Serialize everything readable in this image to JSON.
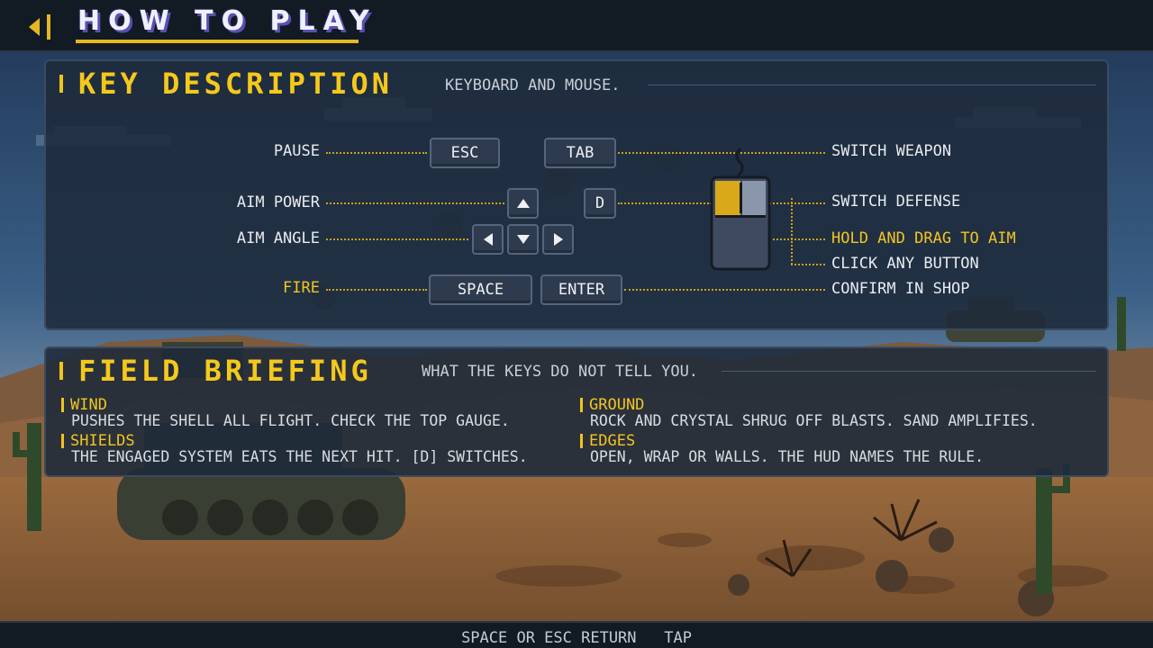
{
  "header": {
    "title": "HOW TO PLAY",
    "back_icon": "chevron-left-icon"
  },
  "key_description": {
    "title": "KEY DESCRIPTION",
    "subtitle": "KEYBOARD AND MOUSE.",
    "actions": {
      "pause": "PAUSE",
      "aim_power": "AIM POWER",
      "aim_angle": "AIM ANGLE",
      "fire": "FIRE",
      "switch_weapon": "SWITCH WEAPON",
      "switch_defense": "SWITCH DEFENSE",
      "hold_drag": "HOLD AND DRAG TO AIM",
      "click_any": "CLICK ANY BUTTON",
      "confirm_shop": "CONFIRM IN SHOP"
    },
    "keys": {
      "esc": "ESC",
      "tab": "TAB",
      "d": "D",
      "space": "SPACE",
      "enter": "ENTER"
    },
    "arrow_icons": [
      "arrow-up-icon",
      "arrow-left-icon",
      "arrow-down-icon",
      "arrow-right-icon"
    ],
    "mouse_icon": "mouse-icon"
  },
  "field_briefing": {
    "title": "FIELD BRIEFING",
    "subtitle": "WHAT THE KEYS DO NOT TELL YOU.",
    "tips": [
      {
        "heading": "WIND",
        "body": "PUSHES THE SHELL ALL FLIGHT. CHECK THE TOP GAUGE."
      },
      {
        "heading": "GROUND",
        "body": "ROCK AND CRYSTAL SHRUG OFF BLASTS. SAND AMPLIFIES."
      },
      {
        "heading": "SHIELDS",
        "body": "THE ENGAGED SYSTEM EATS THE NEXT HIT. [D] SWITCHES."
      },
      {
        "heading": "EDGES",
        "body": "OPEN, WRAP OR WALLS. THE HUD NAMES THE RULE."
      }
    ]
  },
  "footer": {
    "hint": "SPACE OR ESC RETURN   TAP"
  },
  "colors": {
    "accent": "#f5c81c",
    "title_shadow": "#5a4fb0",
    "panel_bg": "#1e2a3a",
    "sky": "#2f4d70",
    "sand": "#b07a45"
  }
}
